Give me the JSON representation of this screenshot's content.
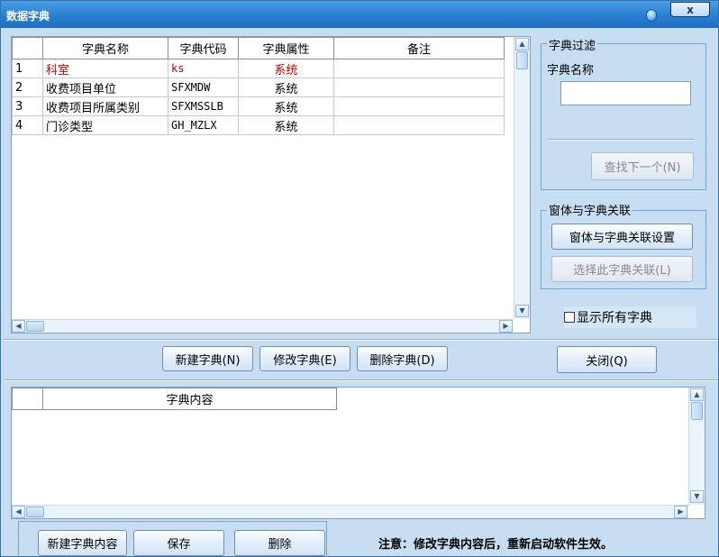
{
  "window": {
    "title": "数据字典",
    "close_label": "x"
  },
  "dict_grid": {
    "headers": [
      "",
      "字典名称",
      "字典代码",
      "字典属性",
      "备注"
    ],
    "rows": [
      [
        "1",
        "科室",
        "ks",
        "系统",
        ""
      ],
      [
        "2",
        "收费项目单位",
        "SFXMDW",
        "系统",
        ""
      ],
      [
        "3",
        "收费项目所属类别",
        "SFXMSSLB",
        "系统",
        ""
      ],
      [
        "4",
        "门诊类型",
        "GH_MZLX",
        "系统",
        ""
      ]
    ],
    "highlight_color": "#c00000"
  },
  "filter_group": {
    "title": "字典过滤",
    "name_label": "字典名称",
    "name_value": "",
    "find_next": "查找下一个(N)"
  },
  "link_group": {
    "title": "窗体与字典关联",
    "settings_button": "窗体与字典关联设置",
    "select_button": "选择此字典关联(L)"
  },
  "show_all": {
    "label": "显示所有字典",
    "checked": false
  },
  "toolbar": {
    "new_dict": "新建字典(N)",
    "edit_dict": "修改字典(E)",
    "delete_dict": "删除字典(D)",
    "close": "关闭(Q)"
  },
  "content_grid": {
    "headers": [
      "",
      "字典内容"
    ]
  },
  "bottom": {
    "new_content": "新建字典内容",
    "save": "保存",
    "delete": "删除",
    "note": "注意：修改字典内容后，重新启动软件生效。"
  }
}
